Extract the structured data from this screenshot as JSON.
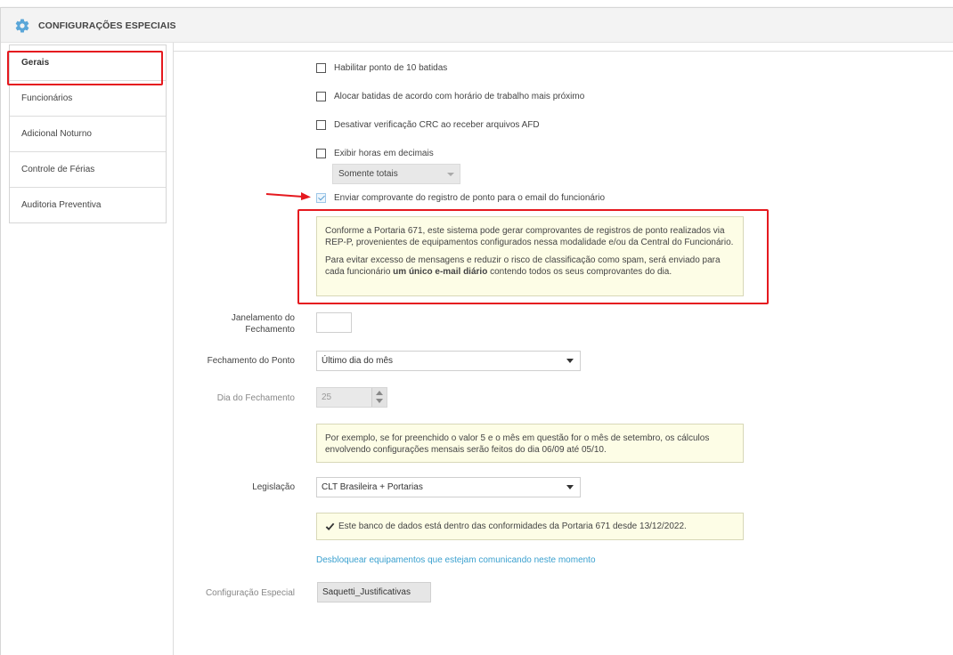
{
  "header": {
    "title": "CONFIGURAÇÕES ESPECIAIS",
    "icon": "gear-icon",
    "accent": "#5aa6d8"
  },
  "sidebar": {
    "items": [
      {
        "label": "Gerais"
      },
      {
        "label": "Funcionários"
      },
      {
        "label": "Adicional Noturno"
      },
      {
        "label": "Controle de Férias"
      },
      {
        "label": "Auditoria Preventiva"
      }
    ]
  },
  "options": {
    "cb1": "Habilitar ponto de 10 batidas",
    "cb2": "Alocar batidas de acordo com horário de trabalho mais próximo",
    "cb3": "Desativar verificação CRC ao receber arquivos AFD",
    "cb4": "Exibir horas em decimais",
    "decimal_select": "Somente totais",
    "cb5": "Enviar comprovante do registro de ponto para o email do funcionário"
  },
  "info_portaria": {
    "p1": "Conforme a Portaria 671, este sistema pode gerar comprovantes de registros de ponto realizados via REP-P, provenientes de equipamentos configurados nessa modalidade e/ou da Central do Funcionário.",
    "p2_before": "Para evitar excesso de mensagens e reduzir o risco de classificação como spam, será enviado para cada funcionário",
    "p2_bold": "um único e-mail diário",
    "p2_after": "contendo todos os seus comprovantes do dia."
  },
  "form": {
    "janelamento_label": "Janelamento do Fechamento",
    "fechamento_label": "Fechamento do Ponto",
    "fechamento_value": "Último dia do mês",
    "dia_label": "Dia do Fechamento",
    "dia_value": "25",
    "example_text": "Por exemplo, se for preenchido o valor 5 e o mês em questão for o mês de setembro, os cálculos envolvendo configurações mensais serão feitos do dia 06/09 até 05/10.",
    "legislacao_label": "Legislação",
    "legislacao_value": "CLT Brasileira + Portarias",
    "conformidade_text": "Este banco de dados está dentro das conformidades da Portaria 671 desde 13/12/2022.",
    "desbloquear_link": "Desbloquear equipamentos que estejam comunicando neste momento",
    "config_label": "Configuração Especial",
    "config_value": "Saquetti_Justificativas"
  },
  "colors": {
    "highlight": "#e5191f",
    "link": "#3aa0cf",
    "info_bg": "#fdfde6"
  }
}
